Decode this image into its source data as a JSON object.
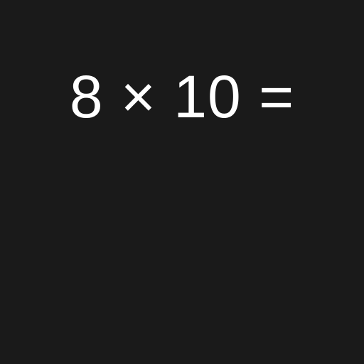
{
  "problem": {
    "expression": "8 × 10 ="
  },
  "colors": {
    "background": "#1a1a1a",
    "text": "#ffffff"
  }
}
